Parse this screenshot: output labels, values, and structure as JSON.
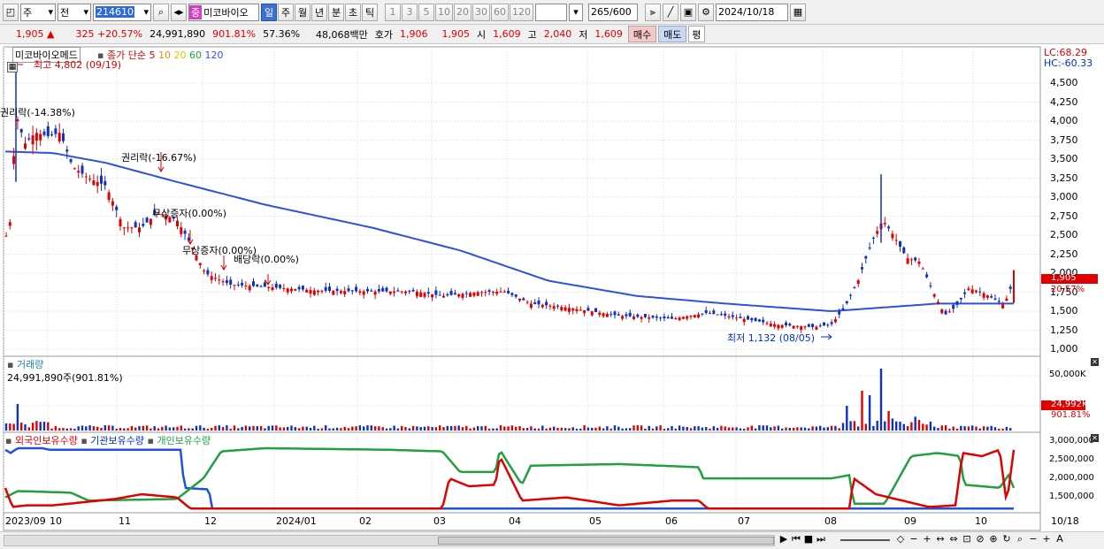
{
  "toolbar": {
    "market": "주",
    "prev_label": "전",
    "code": "214610",
    "name": "미코바이오",
    "name_badge": "중",
    "periods": [
      "일",
      "주",
      "월",
      "년",
      "분",
      "초",
      "틱"
    ],
    "active_period": "일",
    "intervals": [
      "1",
      "3",
      "5",
      "10",
      "20",
      "30",
      "60",
      "120"
    ],
    "count": "265",
    "count_total": "/600",
    "date": "2024/10/18"
  },
  "quote": {
    "price": "1,905",
    "change": "325",
    "change_pct": "+20.57%",
    "volume": "24,991,890",
    "volume_ratio": "901.81%",
    "turnover_pct": "57.36%",
    "amount": "48,068백만",
    "bid_label": "호가",
    "bid1": "1,906",
    "bid2": "1,905",
    "open_label": "시",
    "open": "1,609",
    "high_label": "고",
    "high": "2,040",
    "low_label": "저",
    "low": "1,609",
    "buy_label": "매수",
    "sell_label": "매도",
    "flat_label": "평"
  },
  "chart": {
    "title": "미코바이오메드",
    "ma_label": "종가 단순",
    "ma_periods": [
      "5",
      "10",
      "20",
      "60",
      "120"
    ],
    "lc": "LC:68.29",
    "hc": "HC:-60.33",
    "max_note": "최고 4,802 (09/19)",
    "min_note": "최저 1,132 (08/05)",
    "events": [
      "권리락(-14.38%)",
      "권리락(-16.67%)",
      "무상증자(0.00%)",
      "무상증자(0.00%)",
      "배당락(0.00%)"
    ],
    "price_ticks": [
      "4,500",
      "4,250",
      "4,000",
      "3,750",
      "3,500",
      "3,250",
      "3,000",
      "2,750",
      "2,500",
      "2,250",
      "2,000",
      "1,750",
      "1,500",
      "1,250",
      "1,000"
    ],
    "price_tag": "1,905",
    "pct_tag": "20.57%",
    "volume_title": "거래량",
    "volume_value": "24,991,890주(901.81%)",
    "volume_ticks": [
      "50,000K",
      "25,000K"
    ],
    "volume_tag": "24,992K",
    "volume_pct_tag": "901.81%",
    "holdings": [
      "외국인보유수량",
      "기관보유수량",
      "개인보유수량"
    ],
    "holding_ticks": [
      "3,000,000",
      "2,500,000",
      "2,000,000",
      "1,500,000"
    ],
    "x_labels": [
      "2023/09",
      "10",
      "11",
      "12",
      "2024/01",
      "02",
      "03",
      "04",
      "05",
      "06",
      "07",
      "08",
      "09",
      "10",
      "10/18"
    ],
    "colors": {
      "ma5": "#e00000",
      "ma10": "#f08c00",
      "ma20": "#f0e040",
      "ma60": "#20a040",
      "ma120": "#3050e0",
      "up": "#e00000",
      "down": "#1030c0"
    }
  }
}
